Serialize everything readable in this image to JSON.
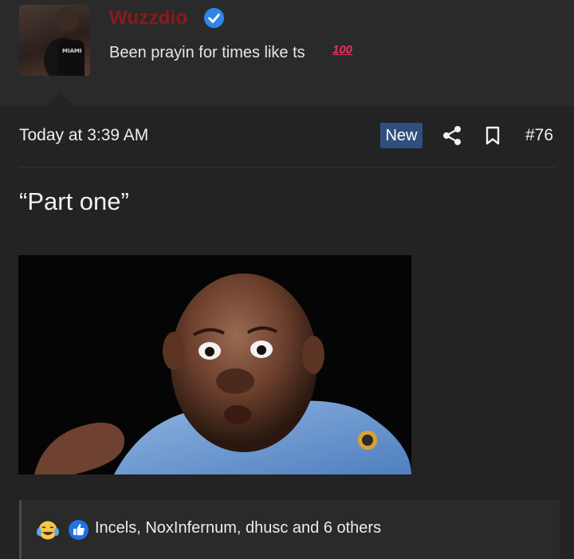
{
  "profile": {
    "username": "Wuzzdio",
    "status_text": "Been prayin for times like ts",
    "status_emoji": "100",
    "avatar_icon": "avatar-photo",
    "verified_icon": "verified-check-icon"
  },
  "post": {
    "timestamp": "Today at 3:39 AM",
    "new_badge": "New",
    "post_number": "#76",
    "text": "“Part one”",
    "media_icon": "reaction-gif"
  },
  "reactions": {
    "summary": "Incels, NoxInfernum, dhusc and 6 others",
    "icons": [
      "crying-laughing-icon",
      "like-icon"
    ]
  },
  "colors": {
    "background": "#232323",
    "header_background": "#2a2a2a",
    "username": "#8b1a1a",
    "verified": "#2f86e8",
    "badge": "#2f4f7e",
    "like": "#1d74e8"
  }
}
